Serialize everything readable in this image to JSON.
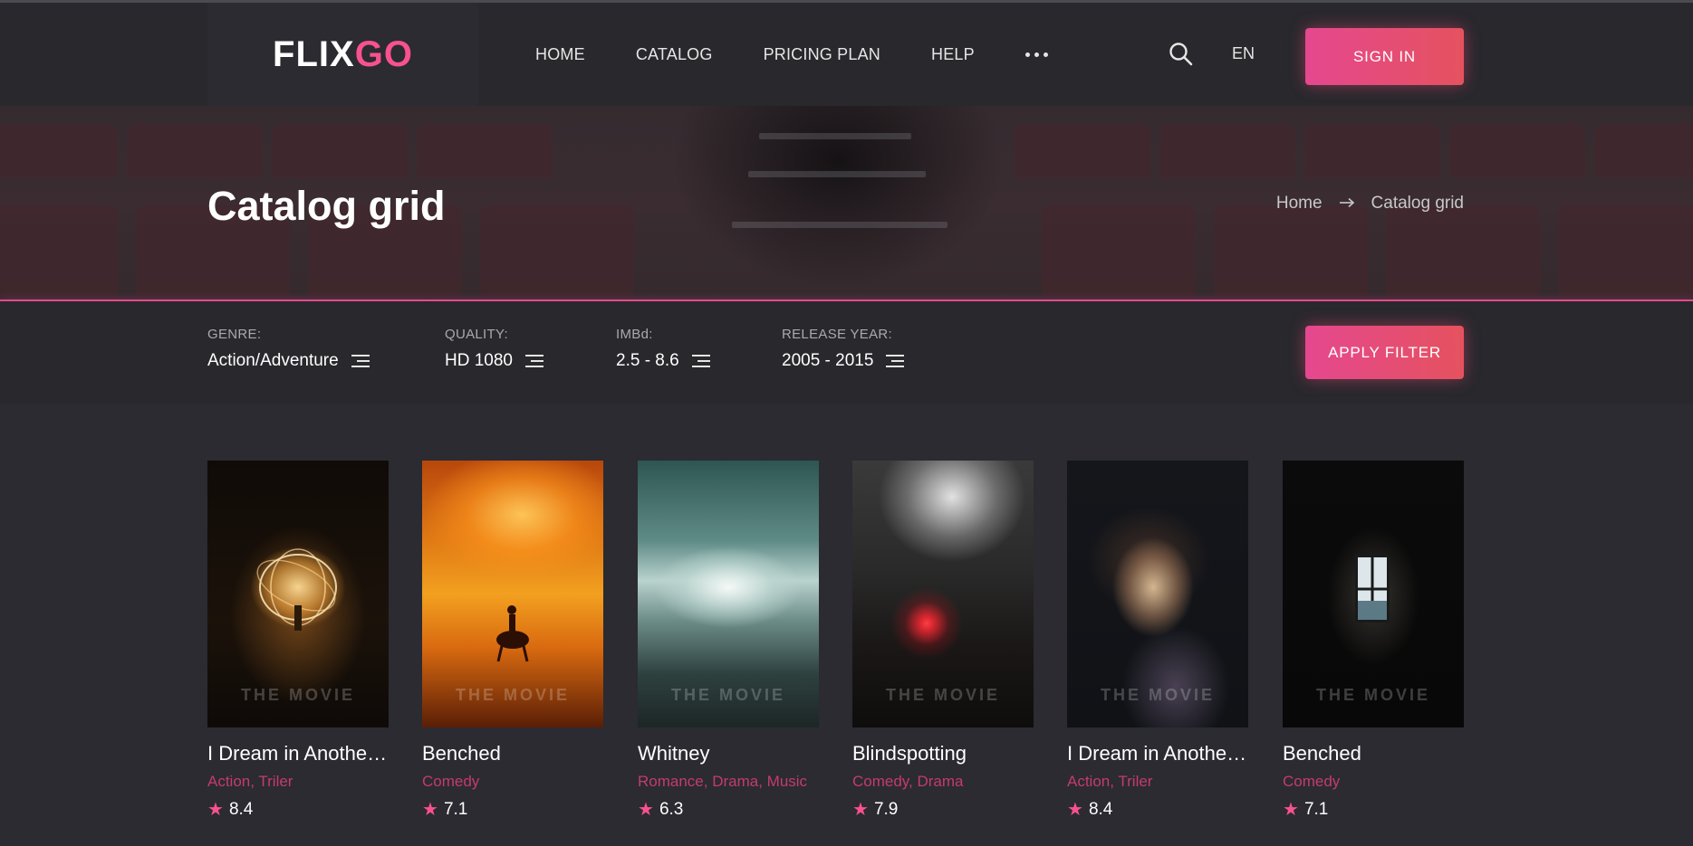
{
  "header": {
    "logo_part1": "FLIX",
    "logo_part2": "GO",
    "nav": [
      "HOME",
      "CATALOG",
      "PRICING PLAN",
      "HELP"
    ],
    "language": "EN",
    "sign_in": "SIGN IN"
  },
  "hero": {
    "title": "Catalog grid",
    "breadcrumb": {
      "home": "Home",
      "current": "Catalog grid"
    }
  },
  "filter": {
    "genre": {
      "label": "GENRE:",
      "value": "Action/Adventure"
    },
    "quality": {
      "label": "QUALITY:",
      "value": "HD 1080"
    },
    "imbd": {
      "label": "IMBd:",
      "value": "2.5 - 8.6"
    },
    "year": {
      "label": "RELEASE YEAR:",
      "value": "2005 - 2015"
    },
    "apply": "APPLY FILTER"
  },
  "poster_watermark": "THE MOVIE",
  "movies": [
    {
      "title": "I Dream in Another Language",
      "genres": "Action, Triler",
      "rating": "8.4"
    },
    {
      "title": "Benched",
      "genres": "Comedy",
      "rating": "7.1"
    },
    {
      "title": "Whitney",
      "genres": "Romance, Drama, Music",
      "rating": "6.3"
    },
    {
      "title": "Blindspotting",
      "genres": "Comedy, Drama",
      "rating": "7.9"
    },
    {
      "title": "I Dream in Another Language",
      "genres": "Action, Triler",
      "rating": "8.4"
    },
    {
      "title": "Benched",
      "genres": "Comedy",
      "rating": "7.1"
    }
  ],
  "colors": {
    "accent": "#e5488f",
    "background": "#2b2b31",
    "genre_text": "#c43b6e"
  }
}
